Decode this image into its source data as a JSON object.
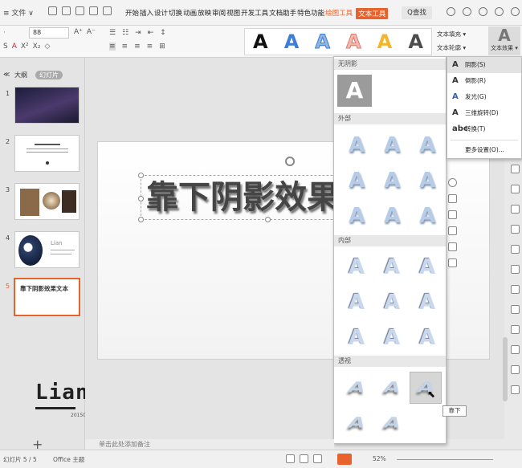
{
  "menubar": {
    "file_label": "≡ 文件 ∨",
    "tabs": [
      "开始",
      "插入",
      "设计",
      "切换",
      "动画",
      "放映",
      "审阅",
      "视图",
      "开发工具",
      "文档助手",
      "特色功能"
    ],
    "draw_tool": "绘图工具",
    "text_tool": "文本工具",
    "search_label": "Q查找"
  },
  "ribbon": {
    "font_size": "88",
    "text_fill": "文本填充 ▾",
    "text_outline": "文本轮廓 ▾",
    "text_effect": "文本效果 ▾",
    "style_glyph": "A"
  },
  "gallery_colors": [
    "#111111",
    "#3b7dd8",
    "#8fb4e6",
    "#f2b8b0",
    "#f3b52a",
    "#4d4d4d"
  ],
  "leftpane": {
    "tab_outline": "大纲",
    "tab_slides": "幻灯片",
    "slide_numbers": [
      "1",
      "2",
      "3",
      "4",
      "5"
    ],
    "slide5_title": "靠下阴影效果文本",
    "slide4_caption": "Lian",
    "lian_text": "Lian",
    "lian_sub": "20150609",
    "add_label": "+"
  },
  "slide": {
    "main_text": "靠下阴影效果文本"
  },
  "dropdown": {
    "no_shadow": "无阴影",
    "outer": "外部",
    "inner": "内部",
    "perspective": "透视",
    "glyph": "A"
  },
  "submenu": {
    "items": [
      "阴影(S)",
      "倒影(R)",
      "发光(G)",
      "三维旋转(D)",
      "转换(T)"
    ],
    "more": "更多设置(O)..."
  },
  "tooltip": "靠下",
  "notes_placeholder": "单击此处添加备注",
  "status": {
    "slide_count": "幻灯片 5 / 5",
    "theme": "Office 主题",
    "zoom": "52%"
  }
}
